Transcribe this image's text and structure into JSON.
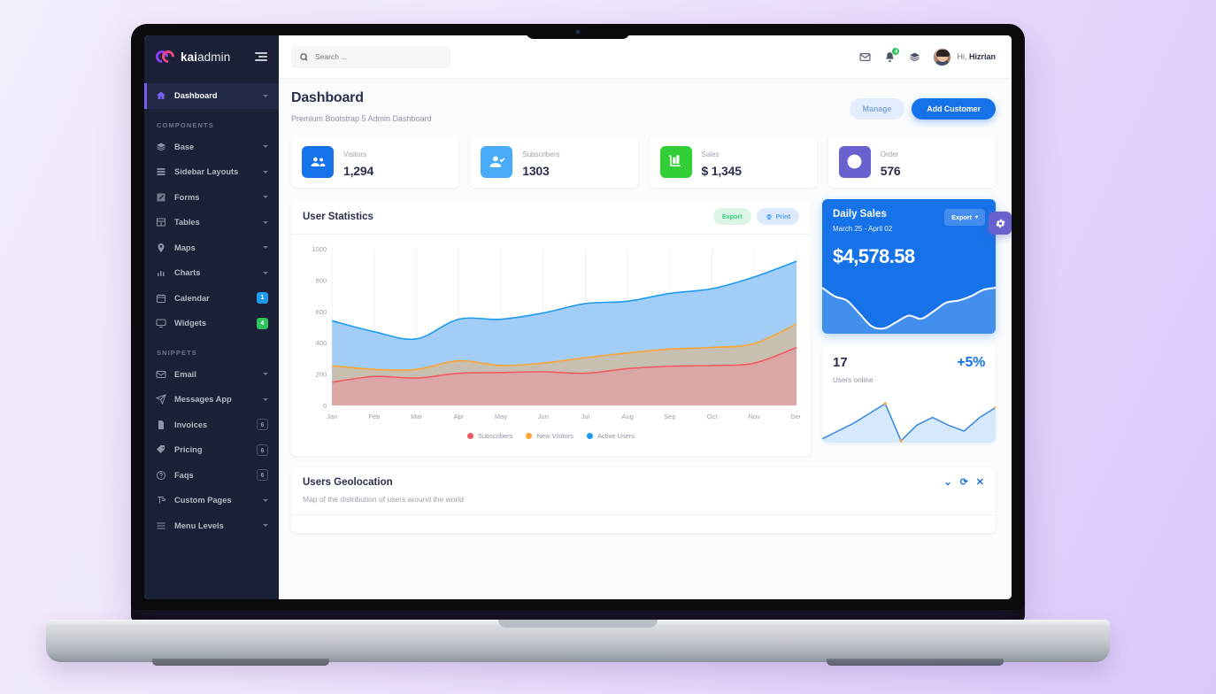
{
  "brand": {
    "name_bold": "kai",
    "name_light": "admin",
    "logo_icon": "cc-logo-icon"
  },
  "sidebar": {
    "toggle_icon": "sidebar-toggle-icon",
    "primary": [
      {
        "label": "Dashboard",
        "icon": "home-icon",
        "active": true,
        "caret": true
      }
    ],
    "sections": [
      {
        "title": "COMPONENTS",
        "items": [
          {
            "label": "Base",
            "icon": "layers-icon",
            "caret": true
          },
          {
            "label": "Sidebar Layouts",
            "icon": "list-icon",
            "caret": true
          },
          {
            "label": "Forms",
            "icon": "edit-icon",
            "caret": true
          },
          {
            "label": "Tables",
            "icon": "table-icon",
            "caret": true
          },
          {
            "label": "Maps",
            "icon": "pin-icon",
            "caret": true
          },
          {
            "label": "Charts",
            "icon": "bar-chart-icon",
            "caret": true
          },
          {
            "label": "Calendar",
            "icon": "calendar-icon",
            "badge": "1",
            "badge_style": "blue"
          },
          {
            "label": "Widgets",
            "icon": "monitor-icon",
            "badge": "4",
            "badge_style": "green"
          }
        ]
      },
      {
        "title": "SNIPPETS",
        "items": [
          {
            "label": "Email",
            "icon": "envelope-icon",
            "caret": true
          },
          {
            "label": "Messages App",
            "icon": "paper-plane-icon",
            "caret": true
          },
          {
            "label": "Invoices",
            "icon": "file-icon",
            "badge": "6",
            "badge_style": "out"
          },
          {
            "label": "Pricing",
            "icon": "tag-icon",
            "badge": "6",
            "badge_style": "out"
          },
          {
            "label": "Faqs",
            "icon": "question-circle-icon",
            "badge": "6",
            "badge_style": "out"
          },
          {
            "label": "Custom Pages",
            "icon": "pen-icon",
            "caret": true
          },
          {
            "label": "Menu Levels",
            "icon": "menu-icon",
            "caret": true
          }
        ]
      }
    ]
  },
  "topbar": {
    "search_placeholder": "Search ...",
    "search_value": "",
    "icons": [
      {
        "name": "envelope-icon"
      },
      {
        "name": "bell-icon",
        "badge": "4"
      },
      {
        "name": "layers-icon"
      }
    ],
    "greeting_prefix": "Hi, ",
    "user_name": "Hizrian"
  },
  "page": {
    "title": "Dashboard",
    "subtitle": "Premium Bootstrap 5 Admin Dashboard",
    "manage_label": "Manage",
    "add_customer_label": "Add Customer"
  },
  "stats": [
    {
      "label": "Visitors",
      "value": "1,294",
      "icon": "users-icon",
      "color": "#1572e8"
    },
    {
      "label": "Subscribers",
      "value": "1303",
      "icon": "user-check-icon",
      "color": "#48abf7"
    },
    {
      "label": "Sales",
      "value": "$ 1,345",
      "icon": "cart-icon",
      "color": "#31ce36"
    },
    {
      "label": "Order",
      "value": "576",
      "icon": "check-circle-icon",
      "color": "#6861ce"
    }
  ],
  "user_statistics": {
    "title": "User Statistics",
    "export_label": "Export",
    "print_label": "Print"
  },
  "chart_data": {
    "type": "area",
    "stacked": true,
    "title": "User Statistics",
    "xlabel": "",
    "ylabel": "",
    "ylim": [
      0,
      1000
    ],
    "yticks": [
      0,
      200,
      400,
      600,
      800,
      1000
    ],
    "grid": "vertical",
    "legend_position": "bottom",
    "categories": [
      "Jan",
      "Feb",
      "Mar",
      "Apr",
      "May",
      "Jun",
      "Jul",
      "Aug",
      "Sep",
      "Oct",
      "Nov",
      "Dec"
    ],
    "series": [
      {
        "name": "Subscribers",
        "color": "#f25961",
        "fill": "#dba5a5",
        "values": [
          148,
          185,
          175,
          205,
          210,
          215,
          205,
          235,
          250,
          255,
          270,
          370
        ]
      },
      {
        "name": "New Visitors",
        "color": "#ffa534",
        "fill": "#c9bfae",
        "values": [
          105,
          45,
          55,
          80,
          45,
          55,
          100,
          100,
          110,
          115,
          125,
          150
        ]
      },
      {
        "name": "Active Users",
        "color": "#1d9bf0",
        "fill": "#9ecbf7",
        "values": [
          287,
          240,
          195,
          265,
          295,
          320,
          345,
          330,
          355,
          375,
          425,
          400
        ]
      }
    ]
  },
  "daily_sales": {
    "title": "Daily Sales",
    "date_range": "March 25 - April 02",
    "amount": "$4,578.58",
    "export_label": "Export",
    "spark": [
      52,
      44,
      40,
      28,
      16,
      14,
      20,
      26,
      23,
      30,
      38,
      40,
      44,
      50,
      52
    ]
  },
  "users_online": {
    "count": "17",
    "percent": "+5%",
    "label": "Users online",
    "spark": [
      44,
      36,
      28,
      18,
      8,
      46,
      30,
      22,
      30,
      36,
      22,
      12
    ]
  },
  "settings": {
    "gear_icon": "gear-icon"
  },
  "geolocation": {
    "title": "Users Geolocation",
    "subtitle": "Map of the distribution of users around the world",
    "actions": [
      {
        "name": "collapse-chevron-icon",
        "glyph": "⌄"
      },
      {
        "name": "refresh-icon",
        "glyph": "⟳"
      },
      {
        "name": "close-icon",
        "glyph": "✕"
      }
    ]
  }
}
